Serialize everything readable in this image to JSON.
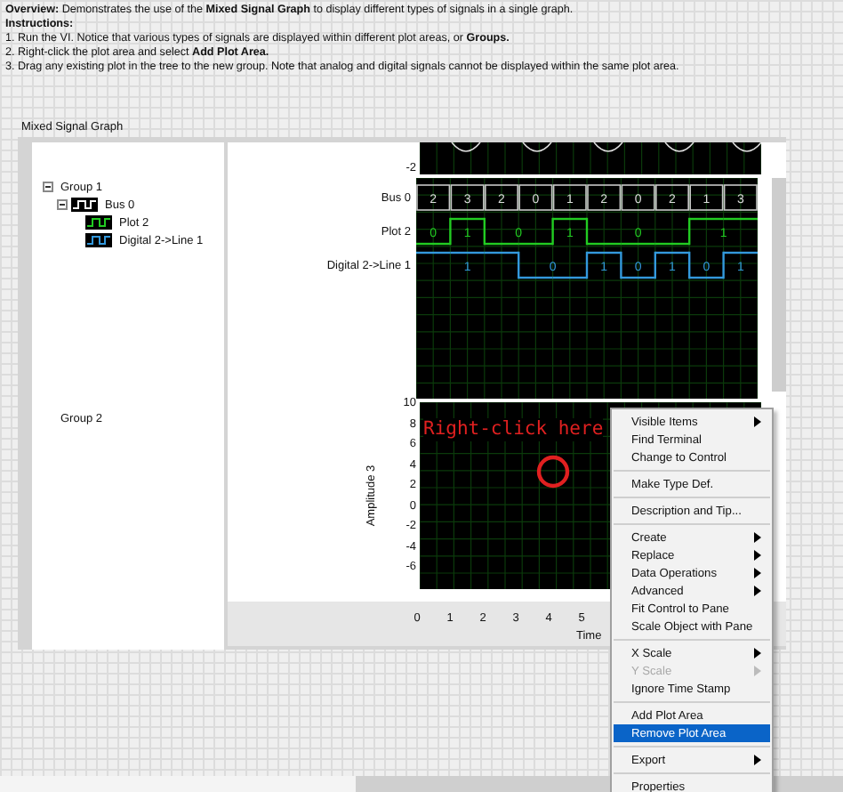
{
  "instructions": [
    "**Overview:** Demonstrates the use of the **Mixed Signal Graph** to display different types of signals in a single graph.",
    "**Instructions:**",
    "1. Run the VI. Notice that various types of signals are displayed within different plot areas, or **Groups.**",
    "2. Right-click the plot area and select **Add Plot Area.**",
    "3. Drag any existing plot in the tree to the new group. Note that analog and digital signals cannot be displayed within the same plot area."
  ],
  "graph": {
    "label": "Mixed Signal Graph",
    "tree": [
      {
        "label": "Group 1",
        "expanded": true,
        "children": [
          {
            "label": "Bus 0",
            "color": "#ffffff",
            "expanded": true,
            "children": [
              {
                "label": "Plot 2",
                "color": "#22cc22"
              },
              {
                "label": "Digital 2->Line 1",
                "color": "#3399dd"
              }
            ]
          }
        ]
      },
      {
        "label": "Group 2"
      }
    ],
    "top_plot": {
      "ytick": "-2"
    },
    "digital_plot": {
      "signals": [
        {
          "name": "Bus 0",
          "kind": "bus",
          "color": "#c8c8c8",
          "values": [
            "2",
            "3",
            "2",
            "0",
            "1",
            "2",
            "0",
            "2",
            "1",
            "3"
          ]
        },
        {
          "name": "Plot 2",
          "kind": "line",
          "color": "#22cc22",
          "high": [
            false,
            true,
            false,
            false,
            true,
            false,
            false,
            false,
            true,
            true
          ],
          "values": [
            "0",
            "1",
            "0",
            "1",
            "0",
            "1"
          ]
        },
        {
          "name": "Digital 2->Line 1",
          "kind": "line",
          "color": "#3399dd",
          "high": [
            true,
            true,
            true,
            false,
            false,
            true,
            false,
            true,
            false,
            true
          ],
          "values": [
            "1",
            "0",
            "1",
            "0",
            "1",
            "0",
            "1"
          ]
        }
      ]
    },
    "analog_plot": {
      "ylabel": "Amplitude 3",
      "yticks": [
        "10",
        "8",
        "6",
        "4",
        "2",
        "0",
        "-2",
        "-4",
        "-6"
      ]
    },
    "xaxis": {
      "ticks": [
        "0",
        "1",
        "2",
        "3",
        "4",
        "5"
      ],
      "label": "Time"
    },
    "annotation": "Right-click here"
  },
  "context_menu": [
    {
      "kind": "item",
      "label": "Visible Items",
      "submenu": true,
      "disabled": false,
      "selected": false
    },
    {
      "kind": "item",
      "label": "Find Terminal",
      "submenu": false,
      "disabled": false,
      "selected": false
    },
    {
      "kind": "item",
      "label": "Change to Control",
      "submenu": false,
      "disabled": false,
      "selected": false
    },
    {
      "kind": "separator"
    },
    {
      "kind": "item",
      "label": "Make Type Def.",
      "submenu": false,
      "disabled": false,
      "selected": false
    },
    {
      "kind": "separator"
    },
    {
      "kind": "item",
      "label": "Description and Tip...",
      "submenu": false,
      "disabled": false,
      "selected": false
    },
    {
      "kind": "separator"
    },
    {
      "kind": "item",
      "label": "Create",
      "submenu": true,
      "disabled": false,
      "selected": false
    },
    {
      "kind": "item",
      "label": "Replace",
      "submenu": true,
      "disabled": false,
      "selected": false
    },
    {
      "kind": "item",
      "label": "Data Operations",
      "submenu": true,
      "disabled": false,
      "selected": false
    },
    {
      "kind": "item",
      "label": "Advanced",
      "submenu": true,
      "disabled": false,
      "selected": false
    },
    {
      "kind": "item",
      "label": "Fit Control to Pane",
      "submenu": false,
      "disabled": false,
      "selected": false
    },
    {
      "kind": "item",
      "label": "Scale Object with Pane",
      "submenu": false,
      "disabled": false,
      "selected": false
    },
    {
      "kind": "separator"
    },
    {
      "kind": "item",
      "label": "X Scale",
      "submenu": true,
      "disabled": false,
      "selected": false
    },
    {
      "kind": "item",
      "label": "Y Scale",
      "submenu": true,
      "disabled": true,
      "selected": false
    },
    {
      "kind": "item",
      "label": "Ignore Time Stamp",
      "submenu": false,
      "disabled": false,
      "selected": false
    },
    {
      "kind": "separator"
    },
    {
      "kind": "item",
      "label": "Add Plot Area",
      "submenu": false,
      "disabled": false,
      "selected": false
    },
    {
      "kind": "item",
      "label": "Remove Plot Area",
      "submenu": false,
      "disabled": false,
      "selected": true
    },
    {
      "kind": "separator"
    },
    {
      "kind": "item",
      "label": "Export",
      "submenu": true,
      "disabled": false,
      "selected": false
    },
    {
      "kind": "separator"
    },
    {
      "kind": "item",
      "label": "Properties",
      "submenu": false,
      "disabled": false,
      "selected": false
    }
  ]
}
